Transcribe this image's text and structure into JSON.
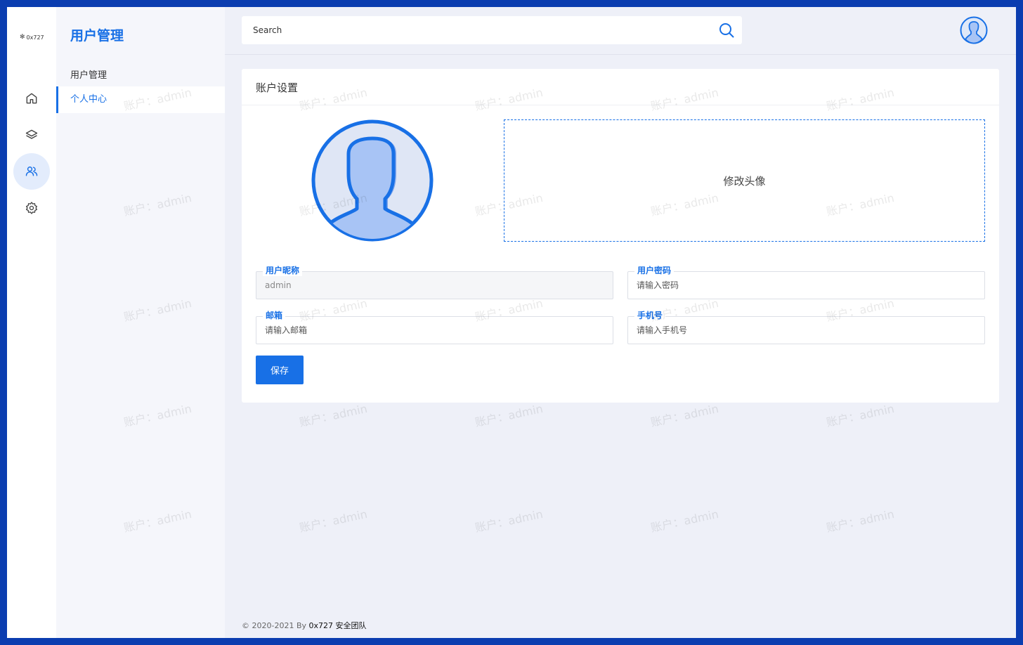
{
  "brand": {
    "logo_text": "0x727"
  },
  "rail": {
    "items": [
      {
        "icon": "home-icon"
      },
      {
        "icon": "layers-icon"
      },
      {
        "icon": "users-icon",
        "active": true
      },
      {
        "icon": "gear-icon"
      }
    ]
  },
  "subnav": {
    "title": "用户管理",
    "group_label": "用户管理",
    "active_item": "个人中心"
  },
  "search": {
    "placeholder": "Search"
  },
  "card": {
    "title": "账户设置",
    "upload_label": "修改头像",
    "fields": {
      "nickname": {
        "label": "用户昵称",
        "value": "admin"
      },
      "password": {
        "label": "用户密码",
        "placeholder": "请输入密码"
      },
      "email": {
        "label": "邮箱",
        "placeholder": "请输入邮箱"
      },
      "phone": {
        "label": "手机号",
        "placeholder": "请输入手机号"
      }
    },
    "save_label": "保存"
  },
  "footer": {
    "prefix": "© 2020-2021 By ",
    "brand": "0x727 安全团队"
  },
  "watermark": "账户：admin",
  "colors": {
    "accent": "#1870e6",
    "frame": "#0b3db0",
    "background": "#eef0f8"
  }
}
